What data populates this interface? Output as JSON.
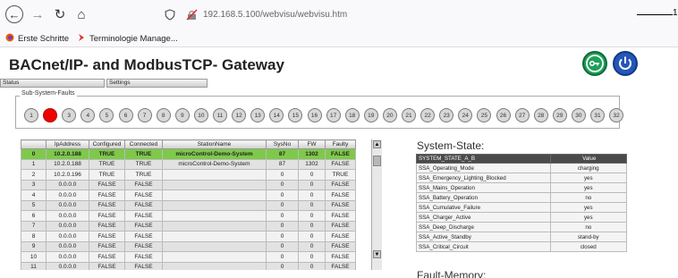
{
  "browser": {
    "url": "192.168.5.100/webvisu/webvisu.htm",
    "annotation_number": "1"
  },
  "bookmarks": [
    {
      "label": "Erste Schritte",
      "icon": "firefox-icon"
    },
    {
      "label": "Terminologie Manage...",
      "icon": "bookmark-icon"
    }
  ],
  "app": {
    "title": "BACnet/IP- and ModbusTCP- Gateway",
    "accent_green": "#1ea05a",
    "accent_blue": "#2457b8"
  },
  "tabs": [
    {
      "label": "Status"
    },
    {
      "label": "Settings"
    }
  ],
  "faults": {
    "label": "Sub-System-Faults",
    "active_color": "#f00000",
    "items": [
      {
        "n": "1",
        "active": false
      },
      {
        "n": "2",
        "active": true
      },
      {
        "n": "3",
        "active": false
      },
      {
        "n": "4",
        "active": false
      },
      {
        "n": "5",
        "active": false
      },
      {
        "n": "6",
        "active": false
      },
      {
        "n": "7",
        "active": false
      },
      {
        "n": "8",
        "active": false
      },
      {
        "n": "9",
        "active": false
      },
      {
        "n": "10",
        "active": false
      },
      {
        "n": "11",
        "active": false
      },
      {
        "n": "12",
        "active": false
      },
      {
        "n": "13",
        "active": false
      },
      {
        "n": "14",
        "active": false
      },
      {
        "n": "15",
        "active": false
      },
      {
        "n": "16",
        "active": false
      },
      {
        "n": "17",
        "active": false
      },
      {
        "n": "18",
        "active": false
      },
      {
        "n": "19",
        "active": false
      },
      {
        "n": "20",
        "active": false
      },
      {
        "n": "21",
        "active": false
      },
      {
        "n": "22",
        "active": false
      },
      {
        "n": "23",
        "active": false
      },
      {
        "n": "24",
        "active": false
      },
      {
        "n": "25",
        "active": false
      },
      {
        "n": "26",
        "active": false
      },
      {
        "n": "27",
        "active": false
      },
      {
        "n": "28",
        "active": false
      },
      {
        "n": "29",
        "active": false
      },
      {
        "n": "30",
        "active": false
      },
      {
        "n": "31",
        "active": false
      },
      {
        "n": "32",
        "active": false
      }
    ]
  },
  "devices": {
    "columns": [
      "",
      "IpAddress",
      "Configured",
      "Connected",
      "StationName",
      "SysNo",
      "FW",
      "Faulty"
    ],
    "rows": [
      [
        "0",
        "10.2.0.188",
        "TRUE",
        "TRUE",
        "microControl-Demo-System",
        "87",
        "1302",
        "FALSE"
      ],
      [
        "1",
        "10.2.0.188",
        "TRUE",
        "TRUE",
        "microControl-Demo-System",
        "87",
        "1302",
        "FALSE"
      ],
      [
        "2",
        "10.2.0.196",
        "TRUE",
        "TRUE",
        "",
        "0",
        "0",
        "TRUE"
      ],
      [
        "3",
        "0.0.0.0",
        "FALSE",
        "FALSE",
        "",
        "0",
        "0",
        "FALSE"
      ],
      [
        "4",
        "0.0.0.0",
        "FALSE",
        "FALSE",
        "",
        "0",
        "0",
        "FALSE"
      ],
      [
        "5",
        "0.0.0.0",
        "FALSE",
        "FALSE",
        "",
        "0",
        "0",
        "FALSE"
      ],
      [
        "6",
        "0.0.0.0",
        "FALSE",
        "FALSE",
        "",
        "0",
        "0",
        "FALSE"
      ],
      [
        "7",
        "0.0.0.0",
        "FALSE",
        "FALSE",
        "",
        "0",
        "0",
        "FALSE"
      ],
      [
        "8",
        "0.0.0.0",
        "FALSE",
        "FALSE",
        "",
        "0",
        "0",
        "FALSE"
      ],
      [
        "9",
        "0.0.0.0",
        "FALSE",
        "FALSE",
        "",
        "0",
        "0",
        "FALSE"
      ],
      [
        "10",
        "0.0.0.0",
        "FALSE",
        "FALSE",
        "",
        "0",
        "0",
        "FALSE"
      ],
      [
        "11",
        "0.0.0.0",
        "FALSE",
        "FALSE",
        "",
        "0",
        "0",
        "FALSE"
      ]
    ],
    "selected_row": 0,
    "selected_color": "#7ec94a"
  },
  "system_state": {
    "title": "System-State:",
    "columns": [
      "SYSTEM_STATE_A_B",
      "Value"
    ],
    "rows": [
      [
        "SSA_Operating_Mode",
        "charging"
      ],
      [
        "SSA_Emergency_Lighting_Blocked",
        "yes"
      ],
      [
        "SSA_Mains_Operation",
        "yes"
      ],
      [
        "SSA_Battery_Operation",
        "no"
      ],
      [
        "SSA_Cumulative_Failure",
        "yes"
      ],
      [
        "SSA_Charger_Active",
        "yes"
      ],
      [
        "SSA_Deep_Discharge",
        "no"
      ],
      [
        "SSA_Active_Standby",
        "stand-by"
      ],
      [
        "SSA_Critical_Circuit",
        "closed"
      ]
    ]
  },
  "fault_memory": {
    "title": "Fault-Memory:"
  }
}
